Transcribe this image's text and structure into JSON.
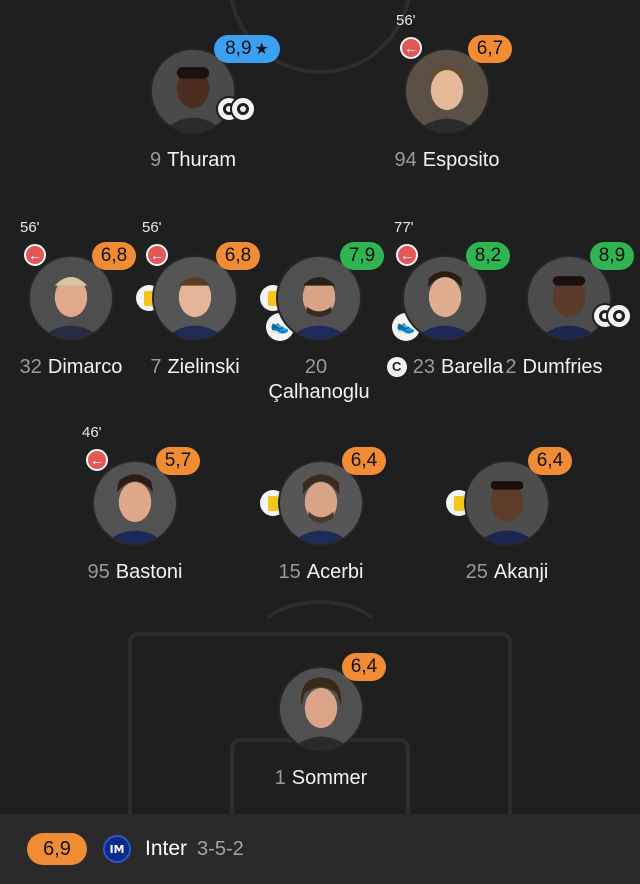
{
  "colors": {
    "background": "#1f1f1f",
    "rating_orange": "#f08c33",
    "rating_green": "#2fb451",
    "rating_blue": "#3ba0f2",
    "sub_red": "#e25757"
  },
  "players": {
    "thuram": {
      "number": "9",
      "name": "Thuram",
      "rating": "8,9",
      "rating_color": "blue",
      "star": "★",
      "goals": 2
    },
    "esposito": {
      "number": "94",
      "name": "Esposito",
      "rating": "6,7",
      "rating_color": "orange",
      "sub_time": "56'",
      "sub_icon": "←"
    },
    "dimarco": {
      "number": "32",
      "name": "Dimarco",
      "rating": "6,8",
      "rating_color": "orange",
      "sub_time": "56'",
      "sub_icon": "←"
    },
    "zielinski": {
      "number": "7",
      "name": "Zielinski",
      "rating": "6,8",
      "rating_color": "orange",
      "sub_time": "56'",
      "sub_icon": "←",
      "yellow_card": true
    },
    "calhanoglu": {
      "number": "20",
      "name": "Çalhanoglu",
      "rating": "7,9",
      "rating_color": "green",
      "yellow_card": true,
      "assist_icon": "boot-icon"
    },
    "barella": {
      "number": "23",
      "name": "Barella",
      "rating": "8,2",
      "rating_color": "green",
      "sub_time": "77'",
      "sub_icon": "←",
      "assist_icon": "boot-icon",
      "captain": "C"
    },
    "dumfries": {
      "number": "2",
      "name": "Dumfries",
      "rating": "8,9",
      "rating_color": "green",
      "goals": 2
    },
    "bastoni": {
      "number": "95",
      "name": "Bastoni",
      "rating": "5,7",
      "rating_color": "orange",
      "sub_time": "46'",
      "sub_icon": "←"
    },
    "acerbi": {
      "number": "15",
      "name": "Acerbi",
      "rating": "6,4",
      "rating_color": "orange",
      "yellow_card": true
    },
    "akanji": {
      "number": "25",
      "name": "Akanji",
      "rating": "6,4",
      "rating_color": "orange",
      "yellow_card": true
    },
    "sommer": {
      "number": "1",
      "name": "Sommer",
      "rating": "6,4",
      "rating_color": "orange"
    }
  },
  "footer": {
    "team_rating": "6,9",
    "team_name": "Inter",
    "formation": "3-5-2",
    "crest_text": "IM"
  }
}
